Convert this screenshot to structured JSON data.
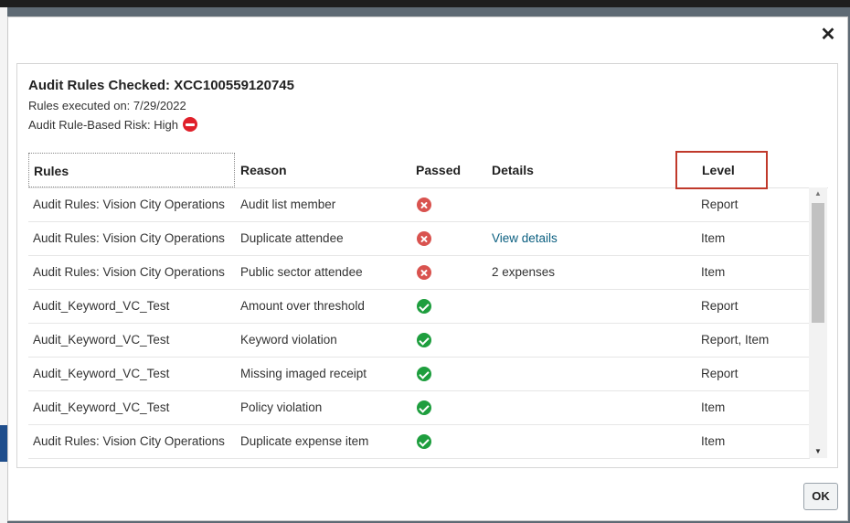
{
  "dialog": {
    "close_glyph": "✕",
    "title": "Audit Rules Checked: XCC100559120745",
    "executed_on": "Rules executed on: 7/29/2022",
    "risk_label": "Audit Rule-Based Risk: High",
    "ok_label": "OK"
  },
  "table": {
    "headers": {
      "rules": "Rules",
      "reason": "Reason",
      "passed": "Passed",
      "details": "Details",
      "level": "Level"
    },
    "rows": [
      {
        "rule": "Audit Rules: Vision City Operations",
        "reason": "Audit list member",
        "passed": false,
        "details": "",
        "details_link": false,
        "level": "Report"
      },
      {
        "rule": "Audit Rules: Vision City Operations",
        "reason": "Duplicate attendee",
        "passed": false,
        "details": "View details",
        "details_link": true,
        "level": "Item"
      },
      {
        "rule": "Audit Rules: Vision City Operations",
        "reason": "Public sector attendee",
        "passed": false,
        "details": "2 expenses",
        "details_link": false,
        "level": "Item"
      },
      {
        "rule": "Audit_Keyword_VC_Test",
        "reason": "Amount over threshold",
        "passed": true,
        "details": "",
        "details_link": false,
        "level": "Report"
      },
      {
        "rule": "Audit_Keyword_VC_Test",
        "reason": "Keyword violation",
        "passed": true,
        "details": "",
        "details_link": false,
        "level": "Report, Item"
      },
      {
        "rule": "Audit_Keyword_VC_Test",
        "reason": "Missing imaged receipt",
        "passed": true,
        "details": "",
        "details_link": false,
        "level": "Report"
      },
      {
        "rule": "Audit_Keyword_VC_Test",
        "reason": "Policy violation",
        "passed": true,
        "details": "",
        "details_link": false,
        "level": "Item"
      },
      {
        "rule": "Audit Rules: Vision City Operations",
        "reason": "Duplicate expense item",
        "passed": true,
        "details": "",
        "details_link": false,
        "level": "Item"
      }
    ]
  },
  "icons": {
    "fail": "x-circle-icon",
    "pass": "check-circle-icon",
    "risk": "no-entry-icon"
  },
  "colors": {
    "fail": "#d9534f",
    "pass": "#1e9e3e",
    "highlight_box": "#c0392b",
    "link": "#0b5f80"
  }
}
